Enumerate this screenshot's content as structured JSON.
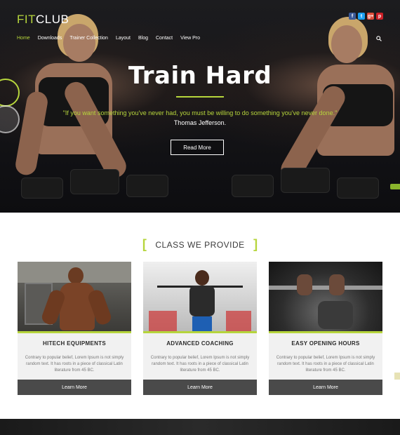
{
  "logo": {
    "part1": "FIT",
    "part2": "CLUB"
  },
  "social": [
    {
      "icon": "facebook-icon",
      "glyph": "f",
      "color": "#3b5998"
    },
    {
      "icon": "twitter-icon",
      "glyph": "t",
      "color": "#1da1f2"
    },
    {
      "icon": "google-plus-icon",
      "glyph": "g+",
      "color": "#dd4b39"
    },
    {
      "icon": "pinterest-icon",
      "glyph": "p",
      "color": "#cb2027"
    }
  ],
  "nav": {
    "items": [
      "Home",
      "Downloads",
      "Trainer Collection",
      "Layout",
      "Blog",
      "Contact",
      "View Pro"
    ],
    "active_index": 0
  },
  "hero": {
    "title": "Train Hard",
    "quote": "\"If you want something you've never had, you must be willing to do something you've never done.\"",
    "author": "Thomas Jefferson.",
    "button": "Read More"
  },
  "section": {
    "bracket_left": "[",
    "title": "CLASS WE PROVIDE",
    "bracket_right": "]"
  },
  "cards": [
    {
      "title": "HITECH EQUIPMENTS",
      "text": "Contrary to popular belief, Lorem Ipsum is not simply random text. It has roots in a piece of classical Latin literature from 45 BC.",
      "button": "Learn More"
    },
    {
      "title": "ADVANCED COACHING",
      "text": "Contrary to popular belief, Lorem Ipsum is not simply random text. It has roots in a piece of classical Latin literature from 45 BC.",
      "button": "Learn More"
    },
    {
      "title": "EASY OPENING HOURS",
      "text": "Contrary to popular belief, Lorem Ipsum is not simply random text. It has roots in a piece of classical Latin literature from 45 BC.",
      "button": "Learn More"
    }
  ],
  "colors": {
    "accent": "#b6d53c",
    "button_dark": "#4a4a4a"
  }
}
